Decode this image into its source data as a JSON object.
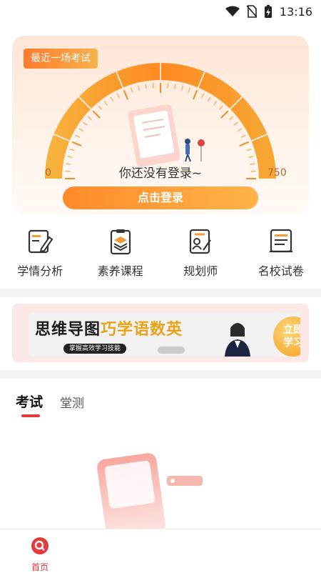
{
  "status_bar": {
    "time": "13:16",
    "icons": [
      "wifi-icon",
      "no-sim-icon",
      "battery-charging-icon"
    ]
  },
  "exam_card": {
    "badge": "最近一场考试",
    "scale_min": "0",
    "scale_max": "750",
    "login_tip": "你还没有登录~",
    "login_button": "点击登录",
    "accent_color": "#ff8a2a"
  },
  "quick_links": [
    {
      "label": "学情分析",
      "icon": "analysis-doc-icon"
    },
    {
      "label": "素养课程",
      "icon": "layers-clipboard-icon"
    },
    {
      "label": "规划师",
      "icon": "planner-icon"
    },
    {
      "label": "名校试卷",
      "icon": "paper-scroll-icon"
    }
  ],
  "banner": {
    "title_part1": "思维导图",
    "title_part2": "巧学语数英",
    "subtitle": "掌握高效学习技能",
    "cta": "立即\n学习"
  },
  "tabs": {
    "active": "考试",
    "other": "堂测"
  },
  "bottom_nav": {
    "home_label": "首页",
    "accent_color": "#e33a3a"
  }
}
